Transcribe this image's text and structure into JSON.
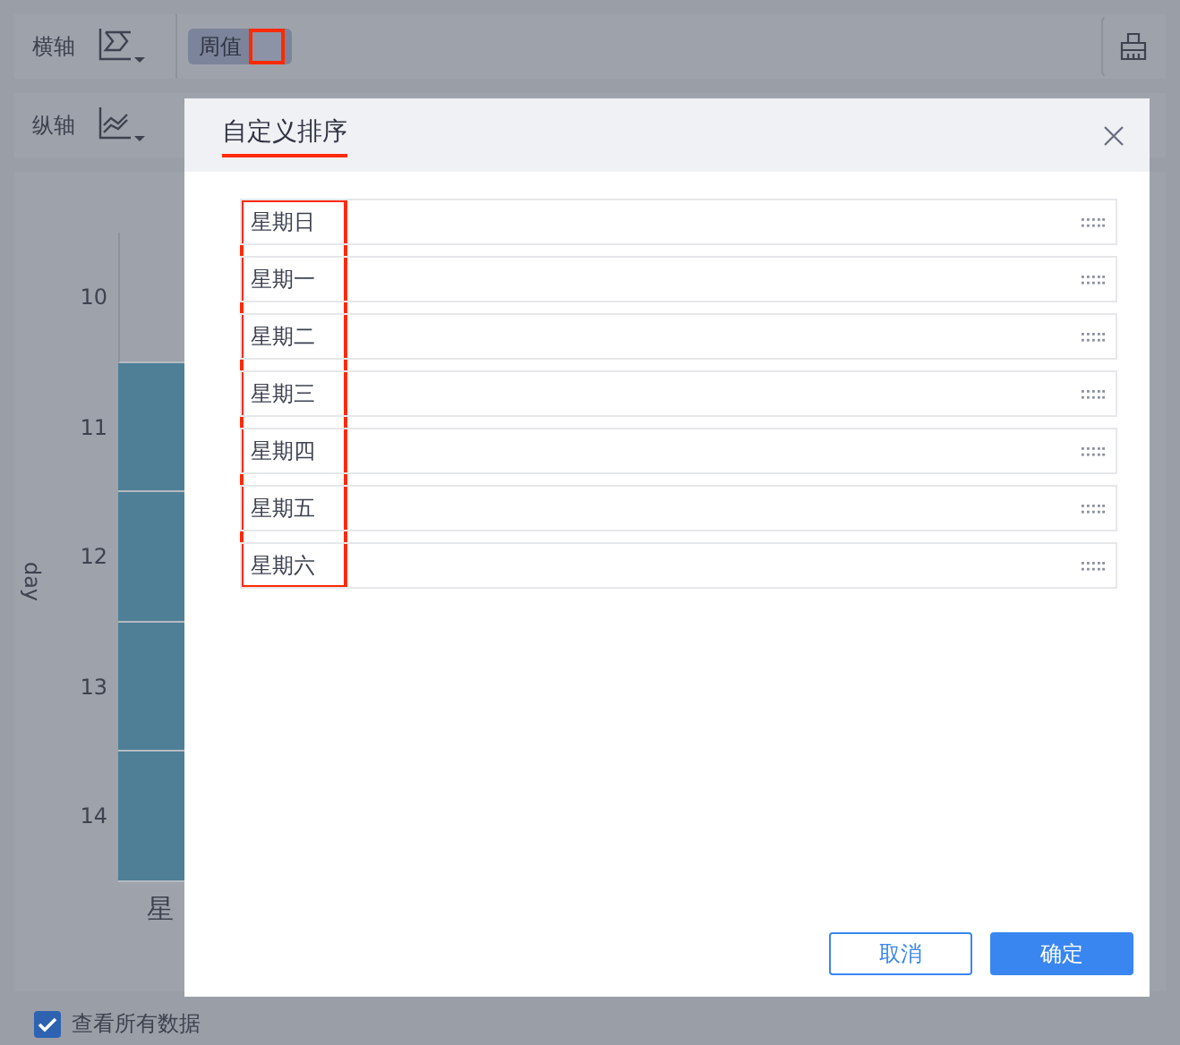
{
  "toolbar": {
    "rows": [
      {
        "label": "横轴",
        "chips": [
          {
            "text": "周值",
            "highlighted": true
          }
        ],
        "print_button": true
      },
      {
        "label": "纵轴",
        "chips": []
      }
    ]
  },
  "chart": {
    "axis_title": "day",
    "rows": [
      {
        "label": "10",
        "filled": false
      },
      {
        "label": "11",
        "filled": true
      },
      {
        "label": "12",
        "filled": true
      },
      {
        "label": "13",
        "filled": true
      },
      {
        "label": "14",
        "filled": true
      }
    ],
    "x_label": "星"
  },
  "show_all": {
    "label": "查看所有数据",
    "checked": true
  },
  "dialog": {
    "title": "自定义排序",
    "items": [
      "星期日",
      "星期一",
      "星期二",
      "星期三",
      "星期四",
      "星期五",
      "星期六"
    ],
    "buttons": [
      {
        "label": "取消",
        "kind": "secondary"
      },
      {
        "label": "确定",
        "kind": "primary"
      }
    ]
  }
}
